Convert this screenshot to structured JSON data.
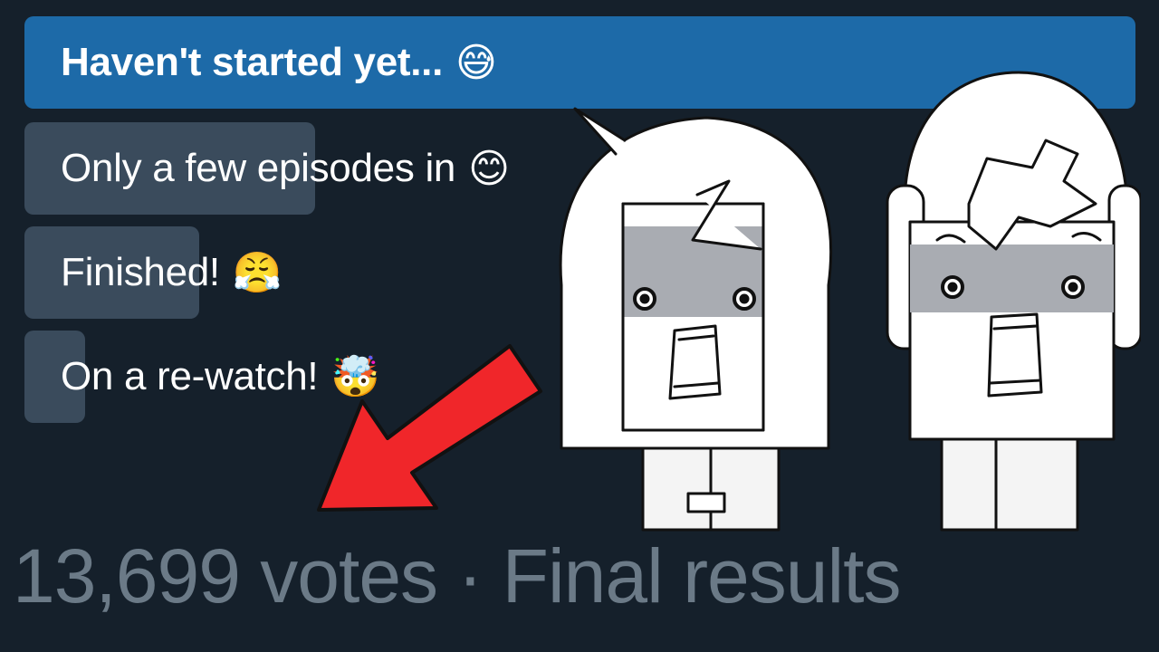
{
  "poll": {
    "options": [
      {
        "label": "Haven't started yet...",
        "emoji": "😅",
        "share": 1.0,
        "winner": true,
        "bar_color": "#1d6aa8"
      },
      {
        "label": "Only a few episodes in",
        "emoji": "😊",
        "share": 0.26,
        "winner": false,
        "bar_color": "#3a4b5c"
      },
      {
        "label": "Finished!",
        "emoji": "😤",
        "share": 0.16,
        "winner": false,
        "bar_color": "#3a4b5c"
      },
      {
        "label": "On a re-watch!",
        "emoji": "🤯",
        "share": 0.055,
        "winner": false,
        "bar_color": "#3a4b5c"
      }
    ],
    "footer": "13,699 votes · Final results"
  },
  "overlay": {
    "arrow_color": "#f0262a",
    "icons": [
      "red-arrow-icon",
      "shocked-characters-drawing"
    ]
  }
}
